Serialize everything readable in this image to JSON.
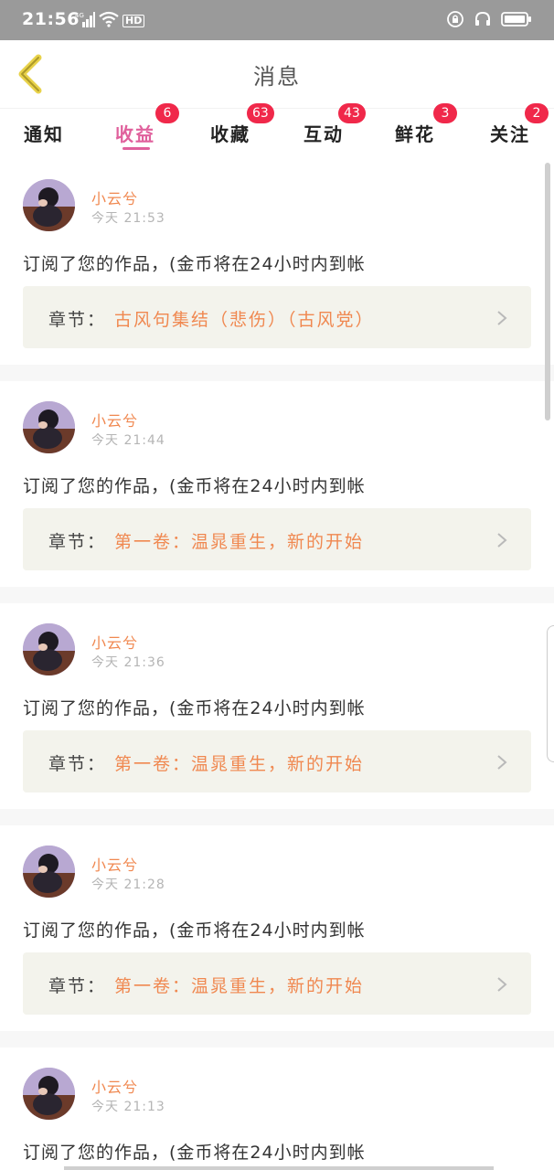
{
  "status_bar": {
    "time": "21:56",
    "network": "4G",
    "hd": "HD"
  },
  "header": {
    "title": "消息"
  },
  "tabs": [
    {
      "label": "通知",
      "badge": ""
    },
    {
      "label": "收益",
      "badge": "6"
    },
    {
      "label": "收藏",
      "badge": "63"
    },
    {
      "label": "互动",
      "badge": "43"
    },
    {
      "label": "鲜花",
      "badge": "3"
    },
    {
      "label": "关注",
      "badge": "2"
    }
  ],
  "active_tab": "收益",
  "colors": {
    "accent": "#e0609c",
    "badge": "#f0284a",
    "author": "#f08850",
    "chapter_bg": "#f3f3ec"
  },
  "messages": [
    {
      "author": "小云兮",
      "time": "今天 21:53",
      "text": "订阅了您的作品，(金币将在24小时内到帐",
      "chapter_label": "章节：",
      "chapter_title": "古风句集结（悲伤）（古风党）"
    },
    {
      "author": "小云兮",
      "time": "今天 21:44",
      "text": "订阅了您的作品，(金币将在24小时内到帐",
      "chapter_label": "章节：",
      "chapter_title": "第一卷：温晁重生，新的开始"
    },
    {
      "author": "小云兮",
      "time": "今天 21:36",
      "text": "订阅了您的作品，(金币将在24小时内到帐",
      "chapter_label": "章节：",
      "chapter_title": "第一卷：温晁重生，新的开始"
    },
    {
      "author": "小云兮",
      "time": "今天 21:28",
      "text": "订阅了您的作品，(金币将在24小时内到帐",
      "chapter_label": "章节：",
      "chapter_title": "第一卷：温晁重生，新的开始"
    },
    {
      "author": "小云兮",
      "time": "今天 21:13",
      "text": "订阅了您的作品，(金币将在24小时内到帐",
      "chapter_label": "",
      "chapter_title": ""
    }
  ]
}
